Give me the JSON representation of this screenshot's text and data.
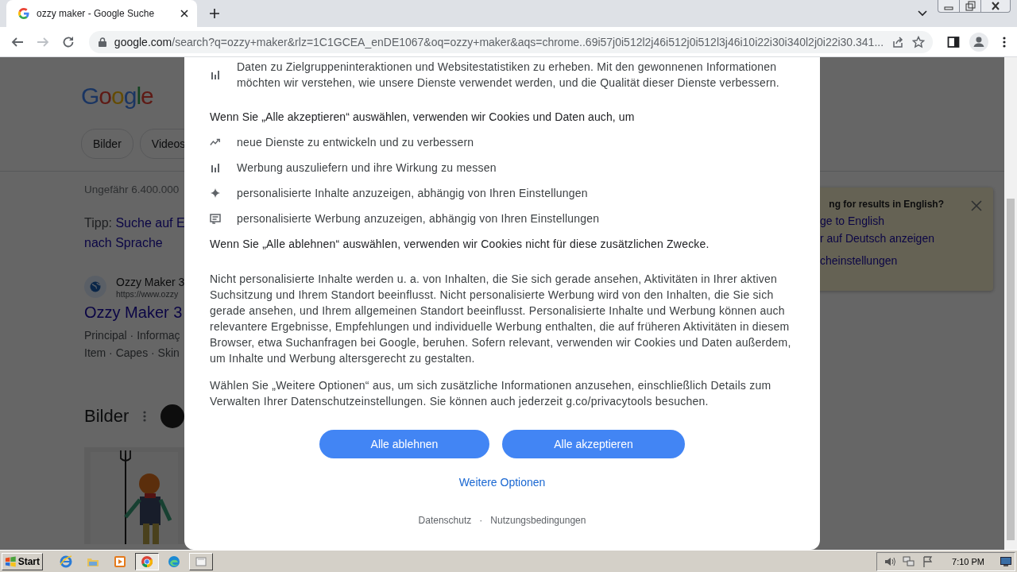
{
  "browser": {
    "tabs": [
      {
        "title": "ozzy maker - Google Suche",
        "selected": true
      }
    ],
    "address": {
      "host": "google.com",
      "path": "/search?q=ozzy+maker&rlz=1C1GCEA_enDE1067&oq=ozzy+maker&aqs=chrome..69i57j0i512l2j46i512j0i512l3j46i10i22i30i340l2j0i22i30.341..."
    }
  },
  "page": {
    "logo": "Google",
    "chips": [
      "Bilder",
      "Videos"
    ],
    "result_stats": "Ungefähr 6.400.000",
    "tip": {
      "label": "Tipp:",
      "link_1": "Suche auf E",
      "link_2": "nach Sprache"
    },
    "result": {
      "site": "Ozzy Maker 3",
      "url": "https://www.ozzy",
      "title": "Ozzy Maker 3",
      "sitelinks_1": "Principal · Informaç",
      "sitelinks_2": "Item · Capes · Skin"
    },
    "images_heading": "Bilder",
    "language_card": {
      "title": "ng for results in English?",
      "links": [
        "ge to English",
        "r auf Deutsch anzeigen",
        "cheinstellungen"
      ]
    }
  },
  "consent": {
    "top_items": [
      {
        "kind": "chart",
        "text": "Daten zu Zielgruppeninteraktionen und Websitestatistiken zu erheben. Mit den gewonnenen Informationen möchten wir verstehen, wie unsere Dienste verwendet werden, und die Qualität dieser Dienste verbessern."
      }
    ],
    "intro": "Wenn Sie „Alle akzeptieren“ auswählen, verwenden wir Cookies und Daten auch, um",
    "purposes": [
      {
        "kind": "trend",
        "text": "neue Dienste zu entwickeln und zu verbessern"
      },
      {
        "kind": "chart",
        "text": "Werbung auszuliefern und ihre Wirkung zu messen"
      },
      {
        "kind": "sparkle",
        "text": "personalisierte Inhalte anzuzeigen, abhängig von Ihren Einstellungen"
      },
      {
        "kind": "ad",
        "text": "personalisierte Werbung anzuzeigen, abhängig von Ihren Einstellungen"
      }
    ],
    "reject_note": "Wenn Sie „Alle ablehnen“ auswählen, verwenden wir Cookies nicht für diese zusätzlichen Zwecke.",
    "paragraphs": [
      "Nicht personalisierte Inhalte werden u. a. von Inhalten, die Sie sich gerade ansehen, Aktivitäten in Ihrer aktiven Suchsitzung und Ihrem Standort beeinflusst. Nicht personalisierte Werbung wird von den Inhalten, die Sie sich gerade ansehen, und Ihrem allgemeinen Standort beeinflusst. Personalisierte Inhalte und Werbung können auch relevantere Ergebnisse, Empfehlungen und individuelle Werbung enthalten, die auf früheren Aktivitäten in diesem Browser, etwa Suchanfragen bei Google, beruhen. Sofern relevant, verwenden wir Cookies und Daten außerdem, um Inhalte und Werbung altersgerecht zu gestalten.",
      "Wählen Sie „Weitere Optionen“ aus, um sich zusätzliche Informationen anzusehen, einschließlich Details zum Verwalten Ihrer Datenschutzeinstellungen. Sie können auch jederzeit g.co/privacytools besuchen."
    ],
    "buttons": [
      "Alle ablehnen",
      "Alle akzeptieren"
    ],
    "more_options": "Weitere Optionen",
    "footer_links": [
      "Datenschutz",
      "Nutzungsbedingungen"
    ],
    "footer_separator": "·"
  },
  "taskbar": {
    "start": "Start",
    "apps": [
      {
        "kind": "ie",
        "active": false
      },
      {
        "kind": "folder",
        "active": false
      },
      {
        "kind": "media",
        "active": false
      },
      {
        "kind": "chrome",
        "active": true
      },
      {
        "kind": "edge",
        "active": false
      },
      {
        "kind": "window",
        "active": false
      }
    ],
    "clock": "7:10 PM"
  }
}
